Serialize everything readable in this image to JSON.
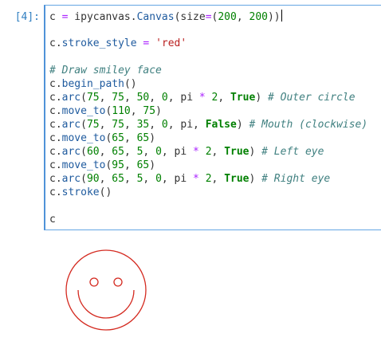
{
  "cell": {
    "prompt": "[4]:",
    "lines": [
      [
        {
          "t": "c",
          "c": "name"
        },
        {
          "t": " ",
          "c": "pun"
        },
        {
          "t": "=",
          "c": "op"
        },
        {
          "t": " ipycanvas",
          "c": "name"
        },
        {
          "t": ".",
          "c": "pun"
        },
        {
          "t": "Canvas",
          "c": "attr"
        },
        {
          "t": "(size",
          "c": "pun"
        },
        {
          "t": "=",
          "c": "op"
        },
        {
          "t": "(",
          "c": "pun"
        },
        {
          "t": "200",
          "c": "num"
        },
        {
          "t": ", ",
          "c": "pun"
        },
        {
          "t": "200",
          "c": "num"
        },
        {
          "t": "))",
          "c": "pun"
        }
      ],
      [],
      [
        {
          "t": "c",
          "c": "name"
        },
        {
          "t": ".",
          "c": "pun"
        },
        {
          "t": "stroke_style",
          "c": "attr"
        },
        {
          "t": " ",
          "c": "pun"
        },
        {
          "t": "=",
          "c": "op"
        },
        {
          "t": " ",
          "c": "pun"
        },
        {
          "t": "'red'",
          "c": "str"
        }
      ],
      [],
      [
        {
          "t": "# Draw smiley face",
          "c": "com"
        }
      ],
      [
        {
          "t": "c",
          "c": "name"
        },
        {
          "t": ".",
          "c": "pun"
        },
        {
          "t": "begin_path",
          "c": "attr"
        },
        {
          "t": "()",
          "c": "pun"
        }
      ],
      [
        {
          "t": "c",
          "c": "name"
        },
        {
          "t": ".",
          "c": "pun"
        },
        {
          "t": "arc",
          "c": "attr"
        },
        {
          "t": "(",
          "c": "pun"
        },
        {
          "t": "75",
          "c": "num"
        },
        {
          "t": ", ",
          "c": "pun"
        },
        {
          "t": "75",
          "c": "num"
        },
        {
          "t": ", ",
          "c": "pun"
        },
        {
          "t": "50",
          "c": "num"
        },
        {
          "t": ", ",
          "c": "pun"
        },
        {
          "t": "0",
          "c": "num"
        },
        {
          "t": ", pi ",
          "c": "pun"
        },
        {
          "t": "*",
          "c": "op"
        },
        {
          "t": " ",
          "c": "pun"
        },
        {
          "t": "2",
          "c": "num"
        },
        {
          "t": ", ",
          "c": "pun"
        },
        {
          "t": "True",
          "c": "kw"
        },
        {
          "t": ") ",
          "c": "pun"
        },
        {
          "t": "# Outer circle",
          "c": "com"
        }
      ],
      [
        {
          "t": "c",
          "c": "name"
        },
        {
          "t": ".",
          "c": "pun"
        },
        {
          "t": "move_to",
          "c": "attr"
        },
        {
          "t": "(",
          "c": "pun"
        },
        {
          "t": "110",
          "c": "num"
        },
        {
          "t": ", ",
          "c": "pun"
        },
        {
          "t": "75",
          "c": "num"
        },
        {
          "t": ")",
          "c": "pun"
        }
      ],
      [
        {
          "t": "c",
          "c": "name"
        },
        {
          "t": ".",
          "c": "pun"
        },
        {
          "t": "arc",
          "c": "attr"
        },
        {
          "t": "(",
          "c": "pun"
        },
        {
          "t": "75",
          "c": "num"
        },
        {
          "t": ", ",
          "c": "pun"
        },
        {
          "t": "75",
          "c": "num"
        },
        {
          "t": ", ",
          "c": "pun"
        },
        {
          "t": "35",
          "c": "num"
        },
        {
          "t": ", ",
          "c": "pun"
        },
        {
          "t": "0",
          "c": "num"
        },
        {
          "t": ", pi, ",
          "c": "pun"
        },
        {
          "t": "False",
          "c": "kw"
        },
        {
          "t": ") ",
          "c": "pun"
        },
        {
          "t": "# Mouth (clockwise)",
          "c": "com"
        }
      ],
      [
        {
          "t": "c",
          "c": "name"
        },
        {
          "t": ".",
          "c": "pun"
        },
        {
          "t": "move_to",
          "c": "attr"
        },
        {
          "t": "(",
          "c": "pun"
        },
        {
          "t": "65",
          "c": "num"
        },
        {
          "t": ", ",
          "c": "pun"
        },
        {
          "t": "65",
          "c": "num"
        },
        {
          "t": ")",
          "c": "pun"
        }
      ],
      [
        {
          "t": "c",
          "c": "name"
        },
        {
          "t": ".",
          "c": "pun"
        },
        {
          "t": "arc",
          "c": "attr"
        },
        {
          "t": "(",
          "c": "pun"
        },
        {
          "t": "60",
          "c": "num"
        },
        {
          "t": ", ",
          "c": "pun"
        },
        {
          "t": "65",
          "c": "num"
        },
        {
          "t": ", ",
          "c": "pun"
        },
        {
          "t": "5",
          "c": "num"
        },
        {
          "t": ", ",
          "c": "pun"
        },
        {
          "t": "0",
          "c": "num"
        },
        {
          "t": ", pi ",
          "c": "pun"
        },
        {
          "t": "*",
          "c": "op"
        },
        {
          "t": " ",
          "c": "pun"
        },
        {
          "t": "2",
          "c": "num"
        },
        {
          "t": ", ",
          "c": "pun"
        },
        {
          "t": "True",
          "c": "kw"
        },
        {
          "t": ") ",
          "c": "pun"
        },
        {
          "t": "# Left eye",
          "c": "com"
        }
      ],
      [
        {
          "t": "c",
          "c": "name"
        },
        {
          "t": ".",
          "c": "pun"
        },
        {
          "t": "move_to",
          "c": "attr"
        },
        {
          "t": "(",
          "c": "pun"
        },
        {
          "t": "95",
          "c": "num"
        },
        {
          "t": ", ",
          "c": "pun"
        },
        {
          "t": "65",
          "c": "num"
        },
        {
          "t": ")",
          "c": "pun"
        }
      ],
      [
        {
          "t": "c",
          "c": "name"
        },
        {
          "t": ".",
          "c": "pun"
        },
        {
          "t": "arc",
          "c": "attr"
        },
        {
          "t": "(",
          "c": "pun"
        },
        {
          "t": "90",
          "c": "num"
        },
        {
          "t": ", ",
          "c": "pun"
        },
        {
          "t": "65",
          "c": "num"
        },
        {
          "t": ", ",
          "c": "pun"
        },
        {
          "t": "5",
          "c": "num"
        },
        {
          "t": ", ",
          "c": "pun"
        },
        {
          "t": "0",
          "c": "num"
        },
        {
          "t": ", pi ",
          "c": "pun"
        },
        {
          "t": "*",
          "c": "op"
        },
        {
          "t": " ",
          "c": "pun"
        },
        {
          "t": "2",
          "c": "num"
        },
        {
          "t": ", ",
          "c": "pun"
        },
        {
          "t": "True",
          "c": "kw"
        },
        {
          "t": ") ",
          "c": "pun"
        },
        {
          "t": "# Right eye",
          "c": "com"
        }
      ],
      [
        {
          "t": "c",
          "c": "name"
        },
        {
          "t": ".",
          "c": "pun"
        },
        {
          "t": "stroke",
          "c": "attr"
        },
        {
          "t": "()",
          "c": "pun"
        }
      ],
      [],
      [
        {
          "t": "c",
          "c": "name"
        }
      ]
    ]
  },
  "output": {
    "stroke_color": "#d42a20"
  }
}
